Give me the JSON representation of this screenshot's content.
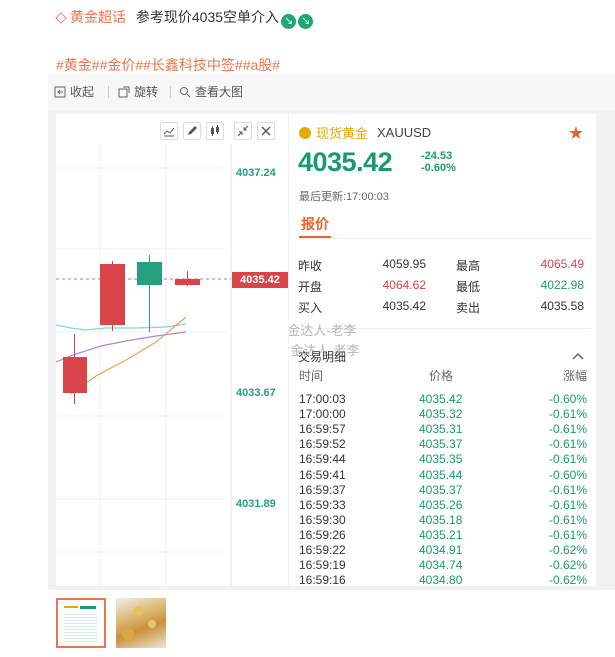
{
  "post": {
    "topic": "黄金超话",
    "text": "参考现价4035空单介入",
    "tags": "#黄金##金价##长鑫科技中签##a股#"
  },
  "toolbar": {
    "collapse": "收起",
    "rotate": "旋转",
    "view_large": "查看大图"
  },
  "chart": {
    "price_labels": [
      "4037.24",
      "4033.67",
      "4031.89"
    ],
    "current_tag": "4035.42"
  },
  "panel": {
    "title": "现货黄金",
    "symbol": "XAUUSD",
    "price": "4035.42",
    "change": "-24.53",
    "change_pct": "-0.60%",
    "updated": "最后更新:17:00:03",
    "tab": "报价",
    "stats": {
      "prev_close_label": "昨收",
      "prev_close": "4059.95",
      "high_label": "最高",
      "high": "4065.49",
      "open_label": "开盘",
      "open": "4064.62",
      "low_label": "最低",
      "low": "4022.98",
      "buy_label": "买入",
      "buy": "4035.42",
      "sell_label": "卖出",
      "sell": "4035.58"
    },
    "trades_title": "交易明细",
    "trades_headers": {
      "time": "时间",
      "price": "价格",
      "change": "涨幅"
    },
    "trades": [
      {
        "time": "17:00:03",
        "price": "4035.42",
        "change": "-0.60%"
      },
      {
        "time": "17:00:00",
        "price": "4035.32",
        "change": "-0.61%"
      },
      {
        "time": "16:59:57",
        "price": "4035.31",
        "change": "-0.61%"
      },
      {
        "time": "16:59:52",
        "price": "4035.37",
        "change": "-0.61%"
      },
      {
        "time": "16:59:44",
        "price": "4035.35",
        "change": "-0.61%"
      },
      {
        "time": "16:59:41",
        "price": "4035.44",
        "change": "-0.60%"
      },
      {
        "time": "16:59:37",
        "price": "4035.37",
        "change": "-0.61%"
      },
      {
        "time": "16:59:33",
        "price": "4035.26",
        "change": "-0.61%"
      },
      {
        "time": "16:59:30",
        "price": "4035.18",
        "change": "-0.61%"
      },
      {
        "time": "16:59:26",
        "price": "4035.21",
        "change": "-0.61%"
      },
      {
        "time": "16:59:22",
        "price": "4034.91",
        "change": "-0.62%"
      },
      {
        "time": "16:59:19",
        "price": "4034.74",
        "change": "-0.62%"
      },
      {
        "time": "16:59:16",
        "price": "4034.80",
        "change": "-0.62%"
      }
    ]
  },
  "watermark": "@黄金达人-老李",
  "colors": {
    "accent": "#eb7350",
    "down": "#1a9a70",
    "up": "#d9434a",
    "gold": "#e8a800"
  }
}
